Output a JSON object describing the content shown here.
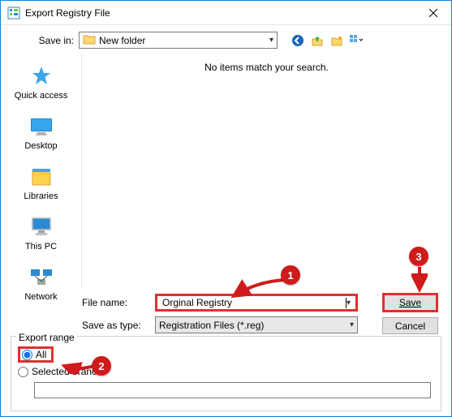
{
  "titlebar": {
    "title": "Export Registry File"
  },
  "save_in": {
    "label": "Save in:",
    "value": "New folder"
  },
  "viewport": {
    "empty_msg": "No items match your search."
  },
  "sidebar": {
    "items": [
      {
        "label": "Quick access"
      },
      {
        "label": "Desktop"
      },
      {
        "label": "Libraries"
      },
      {
        "label": "This PC"
      },
      {
        "label": "Network"
      }
    ]
  },
  "fields": {
    "filename_label": "File name:",
    "filename_value": "Orginal Registry",
    "savetype_label": "Save as type:",
    "savetype_value": "Registration Files (*.reg)"
  },
  "buttons": {
    "save": "Save",
    "cancel": "Cancel"
  },
  "export_range": {
    "legend": "Export range",
    "all": "All",
    "selected_branch": "Selected branch",
    "branch_value": ""
  },
  "annotations": {
    "c1": "1",
    "c2": "2",
    "c3": "3"
  }
}
